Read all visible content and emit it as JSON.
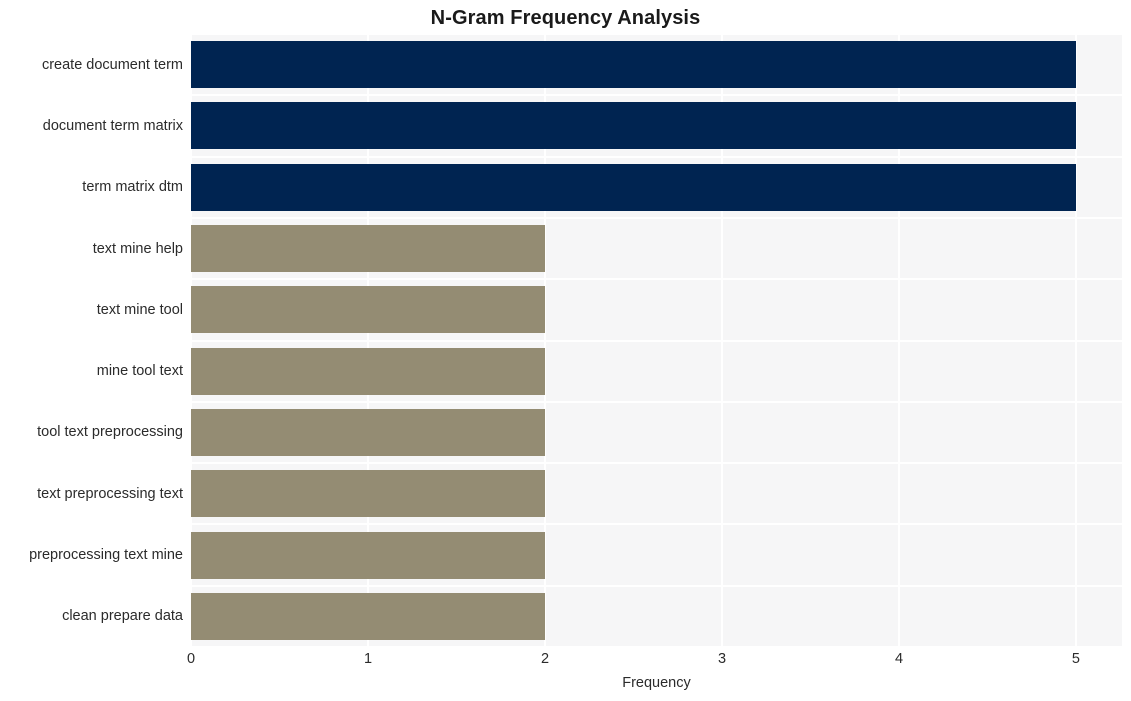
{
  "chart_data": {
    "type": "bar",
    "orientation": "horizontal",
    "title": "N-Gram Frequency Analysis",
    "xlabel": "Frequency",
    "ylabel": "",
    "categories": [
      "create document term",
      "document term matrix",
      "term matrix dtm",
      "text mine help",
      "text mine tool",
      "mine tool text",
      "tool text preprocessing",
      "text preprocessing text",
      "preprocessing text mine",
      "clean prepare data"
    ],
    "values": [
      5,
      5,
      5,
      2,
      2,
      2,
      2,
      2,
      2,
      2
    ],
    "bar_colors": [
      "#002451",
      "#002451",
      "#002451",
      "#948c73",
      "#948c73",
      "#948c73",
      "#948c73",
      "#948c73",
      "#948c73",
      "#948c73"
    ],
    "xlim": [
      0,
      5.26
    ],
    "xticks": [
      0,
      1,
      2,
      3,
      4,
      5
    ],
    "xtick_labels": [
      "0",
      "1",
      "2",
      "3",
      "4",
      "5"
    ],
    "grid": true,
    "grid_color": "#ffffff",
    "plot_background": "#f6f6f7",
    "figure_background": "#ffffff",
    "legend": null,
    "title_color": "#1a1a1a",
    "tick_label_color": "#2b2b2b"
  }
}
